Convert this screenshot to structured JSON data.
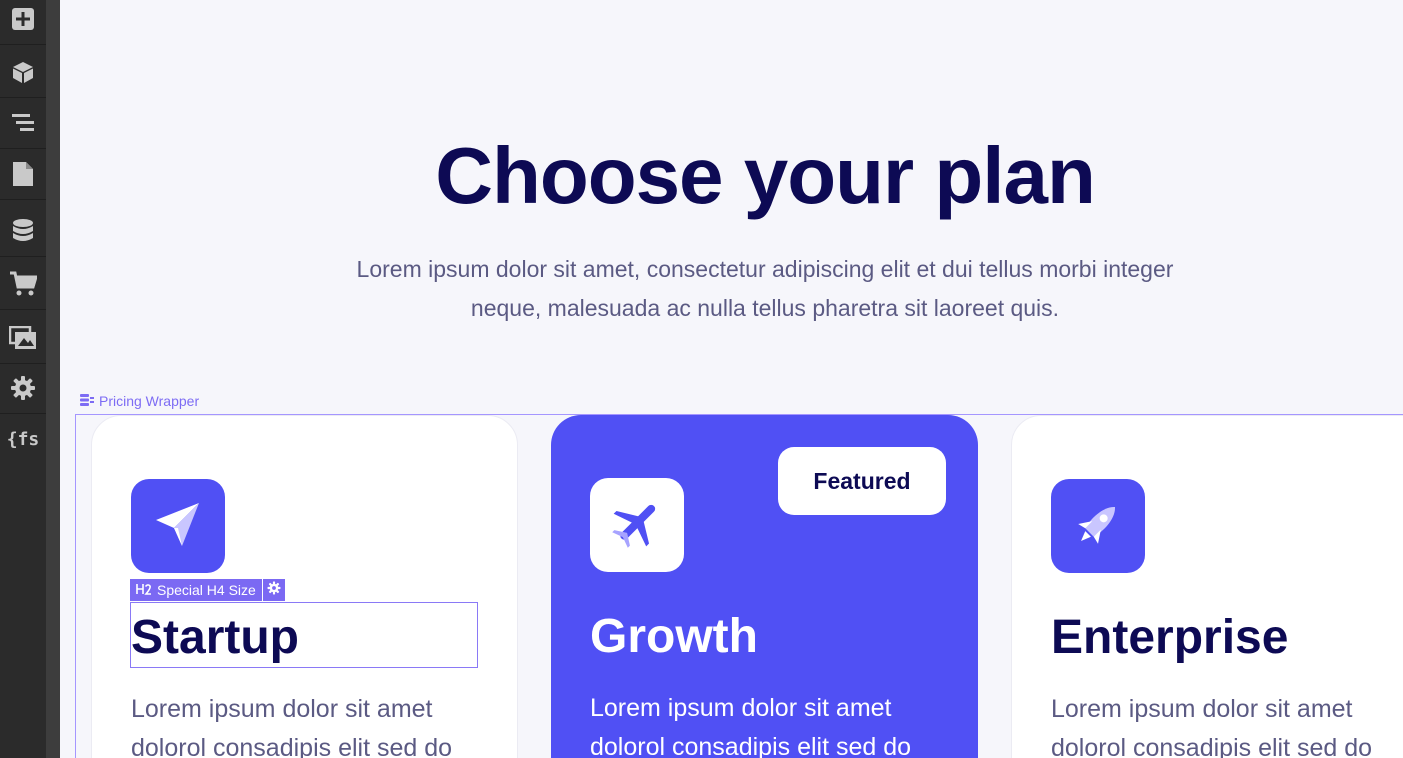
{
  "toolbar": {
    "items": [
      {
        "icon": "add-panel-icon"
      },
      {
        "icon": "components-cube-icon"
      },
      {
        "icon": "navigator-icon"
      },
      {
        "icon": "pages-icon"
      },
      {
        "icon": "cms-database-icon"
      },
      {
        "icon": "ecommerce-cart-icon"
      },
      {
        "icon": "assets-icon"
      },
      {
        "icon": "settings-gear-icon"
      },
      {
        "icon": "finsweet-attributes-icon",
        "label": "{fs"
      }
    ]
  },
  "hero": {
    "title": "Choose your plan",
    "subtitle": "Lorem ipsum dolor sit amet, consectetur adipiscing elit et dui tellus morbi integer neque, malesuada ac nulla tellus pharetra sit laoreet quis."
  },
  "selection": {
    "wrapper_label": "Pricing Wrapper",
    "heading_tag": "Special H4 Size"
  },
  "plans": [
    {
      "name": "Startup",
      "icon": "paper-plane-icon",
      "text": "Lorem ipsum dolor sit amet dolorol consadipis elit sed do"
    },
    {
      "name": "Growth",
      "icon": "airplane-icon",
      "text": "Lorem ipsum dolor sit amet dolorol consadipis elit sed do",
      "badge": "Featured"
    },
    {
      "name": "Enterprise",
      "icon": "rocket-icon",
      "text": "Lorem ipsum dolor sit amet dolorol consadipis elit sed do"
    }
  ],
  "colors": {
    "primary": "#5050f4",
    "heading": "#0d0a54",
    "body_text": "#5b5a83",
    "selection": "#7b69f3",
    "toolbar_bg": "#2b2b2b",
    "canvas_bg": "#f6f6fb"
  }
}
